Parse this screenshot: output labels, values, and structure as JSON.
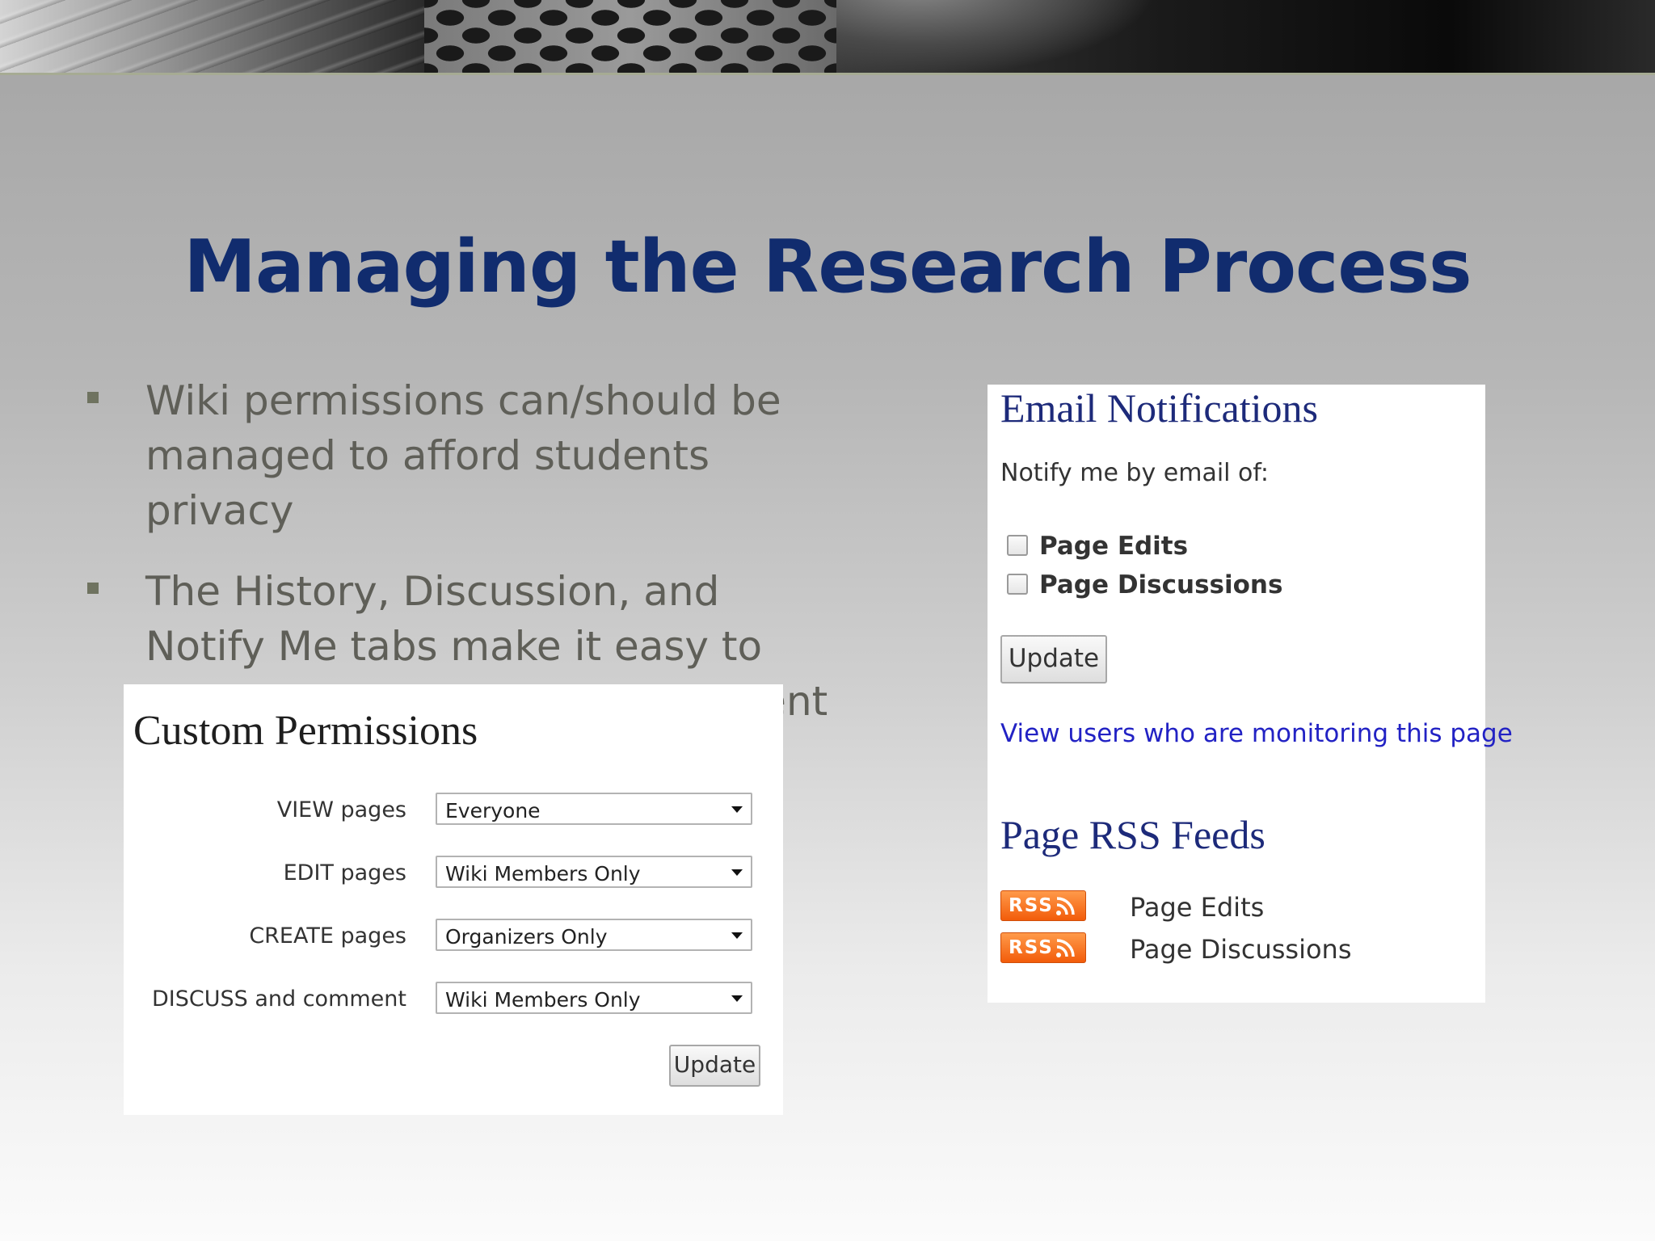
{
  "slide": {
    "title": "Managing the Research Process",
    "bullets": [
      "Wiki permissions can/should be managed to afford students privacy",
      "The History, Discussion, and Notify Me tabs make it easy to monitor and comment on student work"
    ]
  },
  "permissions": {
    "title": "Custom Permissions",
    "rows": [
      {
        "label": "VIEW pages",
        "value": "Everyone"
      },
      {
        "label": "EDIT pages",
        "value": "Wiki Members Only"
      },
      {
        "label": "CREATE pages",
        "value": "Organizers Only"
      },
      {
        "label": "DISCUSS and comment",
        "value": "Wiki Members Only"
      }
    ],
    "update_label": "Update"
  },
  "notifications": {
    "title": "Email Notifications",
    "intro": "Notify me by email of:",
    "checkboxes": [
      {
        "label": "Page Edits",
        "checked": false
      },
      {
        "label": "Page Discussions",
        "checked": false
      }
    ],
    "update_label": "Update",
    "monitor_link": "View users who are monitoring this page"
  },
  "rss": {
    "title": "Page RSS Feeds",
    "badge_text": "RSS",
    "feeds": [
      "Page Edits",
      "Page Discussions"
    ],
    "badge_color": "#f46b1b"
  },
  "colors": {
    "title": "#112c6e",
    "panel_heading": "#1d2a7a",
    "link": "#2222c4",
    "bullet_text": "#5f5f58"
  }
}
